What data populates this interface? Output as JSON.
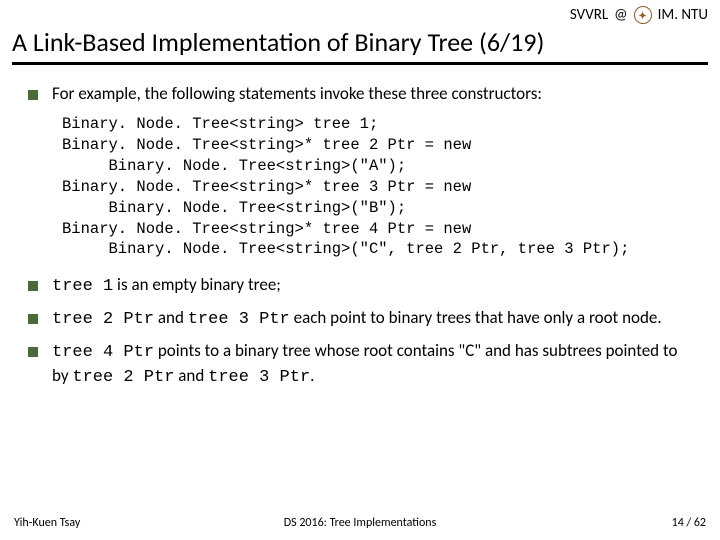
{
  "header": {
    "lab": "SVVRL",
    "org": "IM. NTU",
    "title": "A Link-Based Implementation of Binary Tree (6/19)"
  },
  "bullets": {
    "intro": "For example, the following statements invoke these three constructors:"
  },
  "code": {
    "l1": "Binary. Node. Tree<string> tree 1;",
    "l2": "Binary. Node. Tree<string>* tree 2 Ptr = new",
    "l3": "     Binary. Node. Tree<string>(\"A\");",
    "l4": "Binary. Node. Tree<string>* tree 3 Ptr = new",
    "l5": "     Binary. Node. Tree<string>(\"B\");",
    "l6": "Binary. Node. Tree<string>* tree 4 Ptr = new",
    "l7": "     Binary. Node. Tree<string>(\"C\", tree 2 Ptr, tree 3 Ptr);"
  },
  "bullets2": {
    "b1_code": "tree 1",
    "b1_rest": " is an empty binary tree;",
    "b2_code1": "tree 2 Ptr",
    "b2_mid": " and ",
    "b2_code2": "tree 3 Ptr",
    "b2_rest": " each point to binary trees that have only a root node.",
    "b3_code1": "tree 4 Ptr",
    "b3_mid1": " points to a binary tree whose root contains \"C\" and has subtrees pointed to by ",
    "b3_code2": "tree 2 Ptr",
    "b3_mid2": " and ",
    "b3_code3": "tree 3 Ptr",
    "b3_end": "."
  },
  "footer": {
    "author": "Yih-Kuen Tsay",
    "course": "DS 2016: Tree Implementations",
    "page": "14 / 62"
  }
}
